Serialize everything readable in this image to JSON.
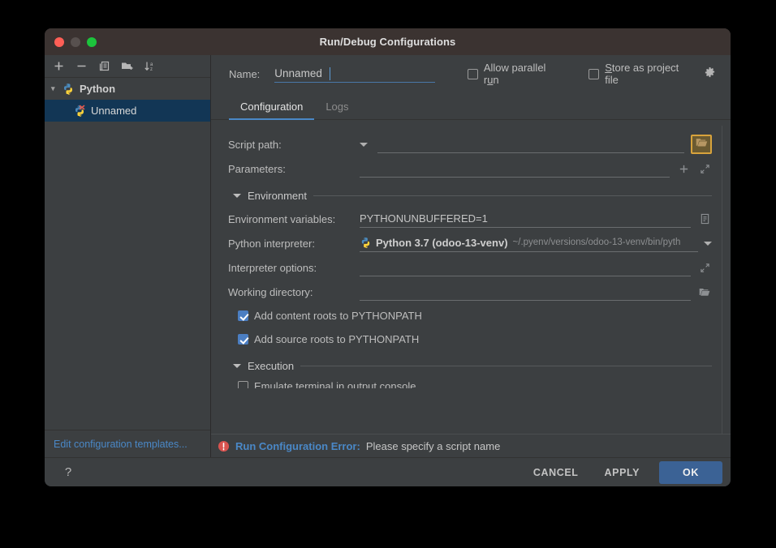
{
  "window": {
    "title": "Run/Debug Configurations",
    "traffic_lights": [
      "close-red",
      "minimize-gray",
      "zoom-green"
    ]
  },
  "sidebar": {
    "toolbar": [
      {
        "name": "add-icon",
        "glyph": "+"
      },
      {
        "name": "remove-icon",
        "glyph": "−"
      },
      {
        "name": "copy-icon",
        "glyph": "copy"
      },
      {
        "name": "new-folder-icon",
        "glyph": "folder-plus"
      },
      {
        "name": "sort-alphabetically-icon",
        "glyph": "sort-az"
      }
    ],
    "tree": [
      {
        "label": "Python",
        "type": "group",
        "expanded": true,
        "icon": "python-icon"
      },
      {
        "label": "Unnamed",
        "type": "config",
        "selected": true,
        "icon": "python-error-icon"
      }
    ],
    "edit_templates_link": "Edit configuration templates..."
  },
  "name_row": {
    "label": "Name:",
    "value": "Unnamed",
    "allow_parallel_run": {
      "label_before": "Allow parallel r",
      "mnemonic": "u",
      "label_after": "n",
      "checked": false
    },
    "store_as_project_file": {
      "mnemonic": "S",
      "label_after": "tore as project file",
      "checked": false
    },
    "gear_icon": "gear-icon"
  },
  "tabs": [
    {
      "label": "Configuration",
      "active": true
    },
    {
      "label": "Logs",
      "active": false
    }
  ],
  "form": {
    "script_path": {
      "label": "Script path:",
      "value": "",
      "has_dropdown": true,
      "browse_icon": "folder-open-icon",
      "browse_highlighted": true,
      "highlight_color": "#d8a33c"
    },
    "parameters": {
      "label": "Parameters:",
      "value": "",
      "icons": [
        "plus-icon",
        "expand-icon"
      ]
    },
    "environment_section": {
      "title": "Environment",
      "expanded": true
    },
    "environment_variables": {
      "label": "Environment variables:",
      "value": "PYTHONUNBUFFERED=1",
      "icon": "edit-list-icon"
    },
    "python_interpreter": {
      "label": "Python interpreter:",
      "icon": "python-icon",
      "value": "Python 3.7 (odoo-13-venv)",
      "path_hint": "~/.pyenv/versions/odoo-13-venv/bin/pyth",
      "has_dropdown": true
    },
    "interpreter_options": {
      "label": "Interpreter options:",
      "value": "",
      "icon": "expand-icon"
    },
    "working_directory": {
      "label": "Working directory:",
      "value": "",
      "icon": "folder-open-icon"
    },
    "add_content_roots": {
      "label": "Add content roots to PYTHONPATH",
      "checked": true
    },
    "add_source_roots": {
      "label": "Add source roots to PYTHONPATH",
      "checked": true
    },
    "execution_section": {
      "title": "Execution",
      "expanded": true
    },
    "emulate_terminal": {
      "label": "Emulate terminal in output console",
      "checked": false
    }
  },
  "error_bar": {
    "icon": "error-icon",
    "title": "Run Configuration Error:",
    "message": "Please specify a script name"
  },
  "footer": {
    "help": "?",
    "cancel": "CANCEL",
    "apply": "APPLY",
    "ok": "OK"
  },
  "colors": {
    "accent_blue": "#4a88c7",
    "ok_button": "#3b6295",
    "highlight_gold": "#d8a33c",
    "error_red": "#d9534f",
    "selection_blue": "#123655"
  }
}
